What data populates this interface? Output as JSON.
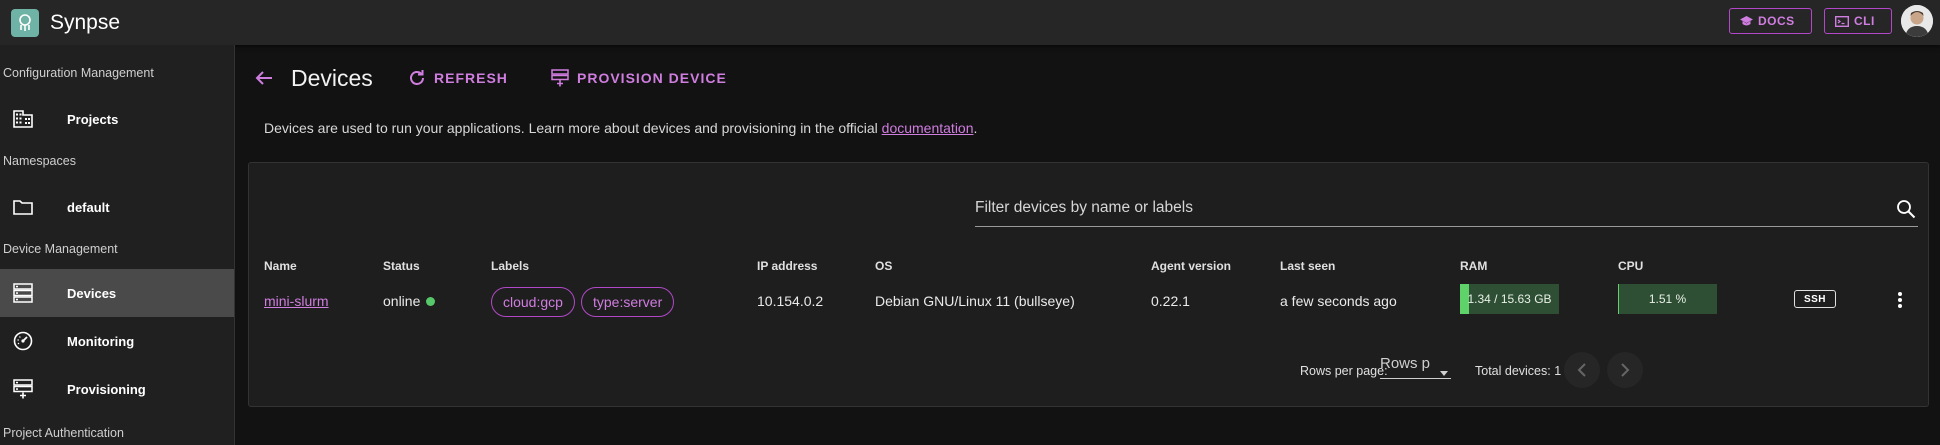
{
  "app": {
    "title": "Synpse"
  },
  "topbar": {
    "docs_label": "DOCS",
    "cli_label": "CLI"
  },
  "sidebar": {
    "sections": [
      {
        "heading": "Configuration Management",
        "items": [
          {
            "label": "Projects",
            "icon": "building-icon"
          }
        ]
      },
      {
        "heading": "Namespaces",
        "items": [
          {
            "label": "default",
            "icon": "folder-icon"
          }
        ]
      },
      {
        "heading": "Device Management",
        "items": [
          {
            "label": "Devices",
            "icon": "server-icon",
            "active": true
          },
          {
            "label": "Monitoring",
            "icon": "gauge-icon"
          },
          {
            "label": "Provisioning",
            "icon": "provision-icon"
          }
        ]
      },
      {
        "heading": "Project Authentication",
        "items": []
      }
    ]
  },
  "page": {
    "title": "Devices",
    "refresh_label": "REFRESH",
    "provision_label": "PROVISION DEVICE",
    "intro_text": "Devices are used to run your applications. Learn more about devices and provisioning in the official ",
    "intro_link": "documentation",
    "intro_tail": "."
  },
  "table": {
    "search_placeholder": "Filter devices by name or labels",
    "columns": [
      "Name",
      "Status",
      "Labels",
      "IP address",
      "OS",
      "Agent version",
      "Last seen",
      "RAM",
      "CPU"
    ],
    "rows": [
      {
        "name": "mini-slurm",
        "status": "online",
        "labels": [
          "cloud:gcp",
          "type:server"
        ],
        "ip": "10.154.0.2",
        "os": "Debian GNU/Linux 11 (bullseye)",
        "agent_version": "0.22.1",
        "last_seen": "a few seconds ago",
        "ram_text": "1.34 / 15.63 GB",
        "ram_fraction": 0.086,
        "cpu_text": "1.51 %",
        "cpu_fraction": 0.0151,
        "ssh_label": "SSH"
      }
    ],
    "footer": {
      "rows_per_page_label": "Rows per page:",
      "rows_per_page_value": "Rows p",
      "total_label": "Total devices: 1"
    }
  },
  "colors": {
    "accent": "#d07de0",
    "online": "#56c86a",
    "bar_fill": "#5fd36a",
    "bar_bg": "#2e4f33"
  }
}
